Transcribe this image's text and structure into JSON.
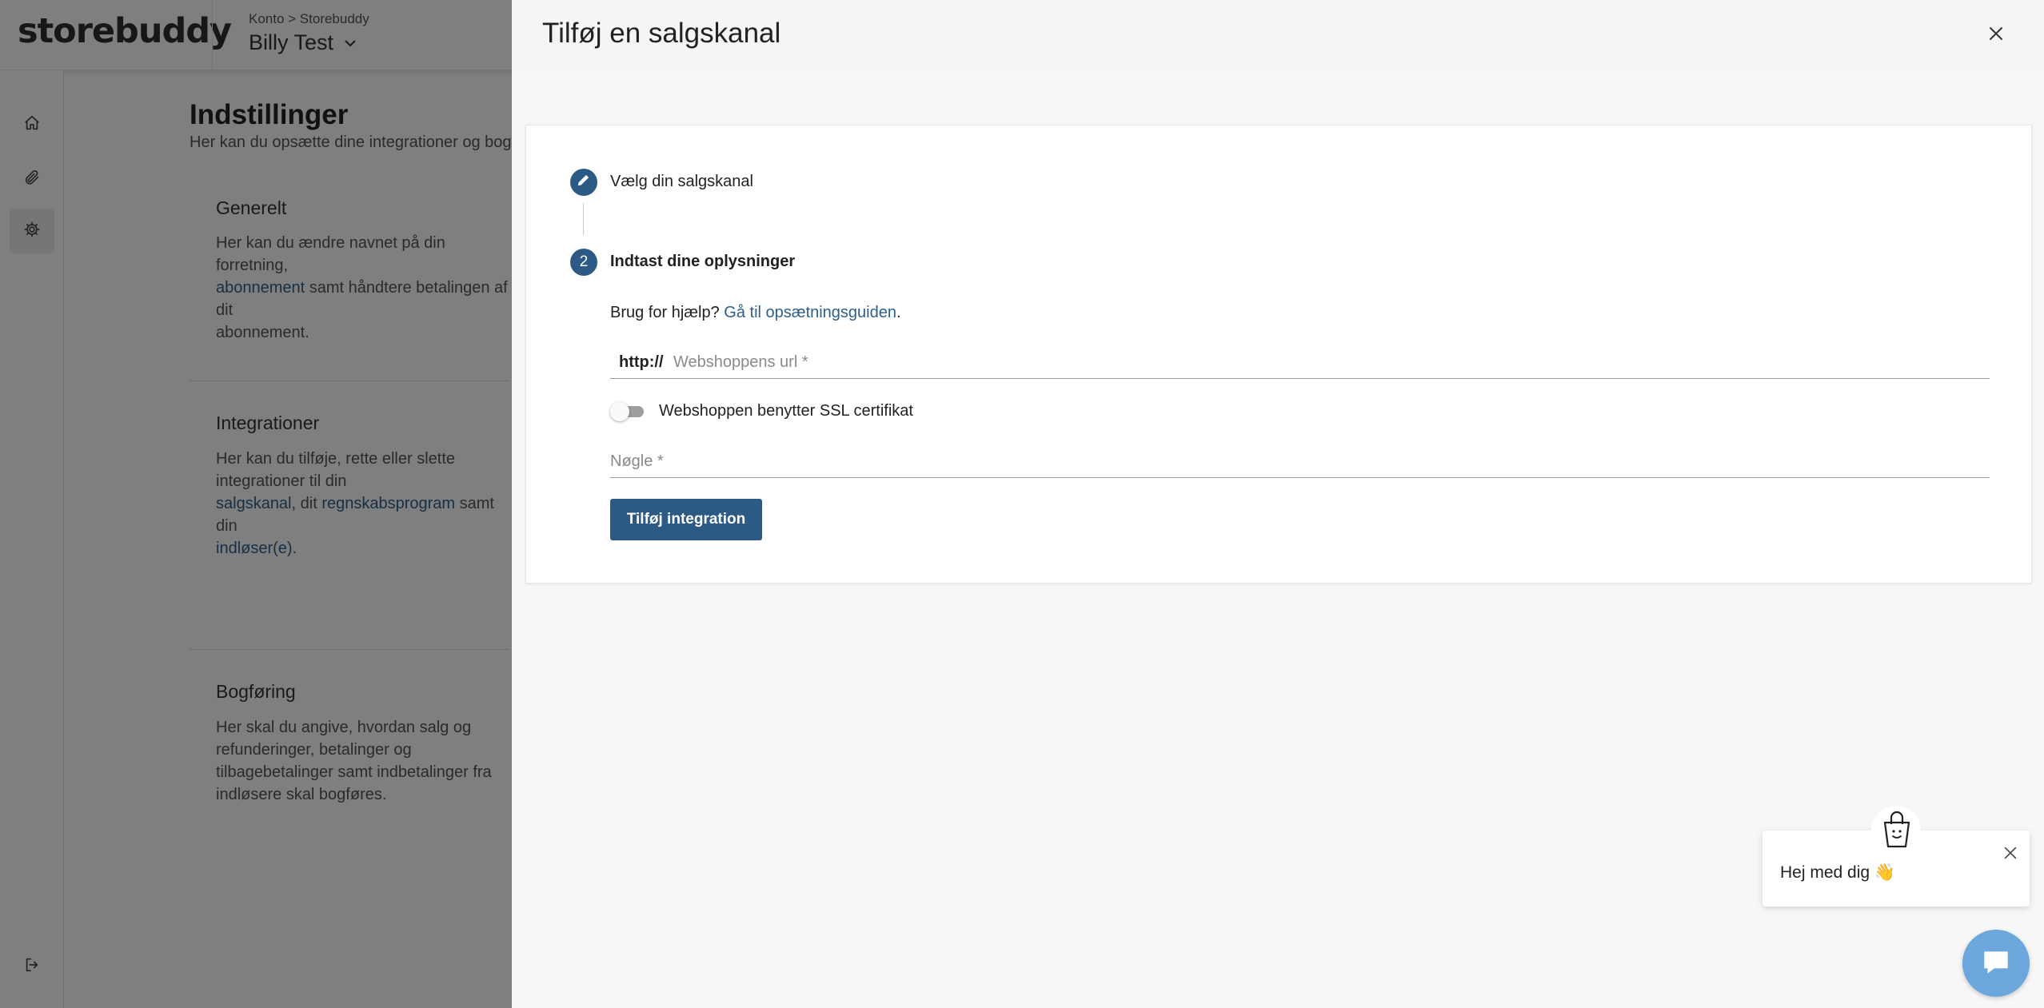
{
  "app": {
    "logo": "storebuddy",
    "breadcrumb": "Konto > Storebuddy",
    "account_name": "Billy Test",
    "page_title": "Indstillinger",
    "page_subtitle": "Her kan du opsætte dine integrationer og bogføring",
    "sections": {
      "generelt": {
        "title": "Generelt",
        "text_1": "Her kan du ændre navnet på din forretning,",
        "link": "abonnement",
        "text_2": " samt håndtere betalingen af dit",
        "text_3": "abonnement."
      },
      "integrationer": {
        "title": "Integrationer",
        "text_1": "Her kan du tilføje, rette eller slette integrationer til din",
        "link_1": "salgskanal",
        "text_2": ", dit ",
        "link_2": "regnskabsprogram",
        "text_3": " samt din",
        "link_3": "indløser(e)",
        "text_4": "."
      },
      "bogforing": {
        "title": "Bogføring",
        "text": "Her skal du angive, hvordan salg og refunderinger, betalinger og tilbagebetalinger samt indbetalinger fra indløsere skal bogføres."
      }
    },
    "sidebar_icons": [
      "home-icon",
      "paperclip-icon",
      "gear-icon",
      "logout-icon"
    ]
  },
  "drawer": {
    "title": "Tilføj en salgskanal",
    "steps": [
      {
        "number": "",
        "label": "Vælg din salgskanal",
        "icon": "pencil-icon"
      },
      {
        "number": "2",
        "label": "Indtast dine oplysninger"
      }
    ],
    "help": {
      "prefix": "Brug for hjælp? ",
      "link": "Gå til opsætningsguiden",
      "suffix": "."
    },
    "url_field": {
      "prefix": "http://",
      "placeholder": "Webshoppens url *",
      "value": ""
    },
    "ssl_toggle": {
      "label": "Webshoppen benytter SSL certifikat",
      "checked": false
    },
    "key_field": {
      "placeholder": "Nøgle *",
      "value": ""
    },
    "submit_label": "Tilføj integration"
  },
  "chat": {
    "greeting": "Hej med dig 👋",
    "launcher_icon": "chat-icon"
  },
  "colors": {
    "primary": "#2c5a85",
    "link": "#2d5f8b",
    "chat_launcher": "#6ba7dd"
  }
}
